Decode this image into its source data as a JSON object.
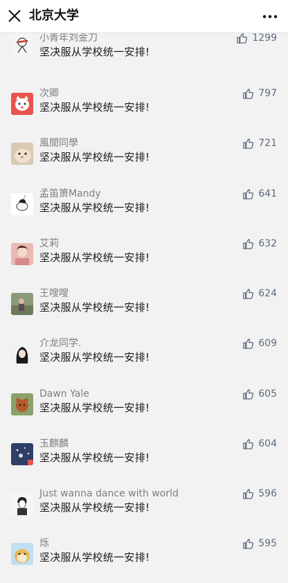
{
  "header": {
    "title": "北京大学",
    "close_icon": "close-icon",
    "more_icon": "more-icon"
  },
  "colors": {
    "background": "#f2f2f2",
    "like_accent": "#5b6b80"
  },
  "comments": [
    {
      "name": "小青年刘金刀",
      "text": "坚决服从学校统一安排!",
      "likes": "1299",
      "avatar_icon": "avatar-drawing"
    },
    {
      "name": "次卿",
      "text": "坚决服从学校统一安排!",
      "likes": "797",
      "avatar_icon": "avatar-cat-red"
    },
    {
      "name": "風間同學",
      "text": "坚决服从学校统一安排!",
      "likes": "721",
      "avatar_icon": "avatar-hamster"
    },
    {
      "name": "孟笛箫Mandy",
      "text": "坚决服从学校统一安排!",
      "likes": "641",
      "avatar_icon": "avatar-unicorn"
    },
    {
      "name": "艾莉",
      "text": "坚决服从学校统一安排!",
      "likes": "632",
      "avatar_icon": "avatar-girl"
    },
    {
      "name": "王嗖嗖",
      "text": "坚决服从学校统一安排!",
      "likes": "624",
      "avatar_icon": "avatar-outdoor"
    },
    {
      "name": "介龙同学.",
      "text": "坚决服从学校统一安排!",
      "likes": "609",
      "avatar_icon": "avatar-longhair"
    },
    {
      "name": "Dawn Yale",
      "text": "坚决服从学校统一安排!",
      "likes": "605",
      "avatar_icon": "avatar-bear"
    },
    {
      "name": "玉麒麟",
      "text": "坚决服从学校统一安排!",
      "likes": "604",
      "avatar_icon": "avatar-night"
    },
    {
      "name": "Just wanna dance with world",
      "text": "坚决服从学校统一安排!",
      "likes": "596",
      "avatar_icon": "avatar-sketch"
    },
    {
      "name": "烁",
      "text": "坚决服从学校统一安排!",
      "likes": "595",
      "avatar_icon": "avatar-doge"
    }
  ]
}
